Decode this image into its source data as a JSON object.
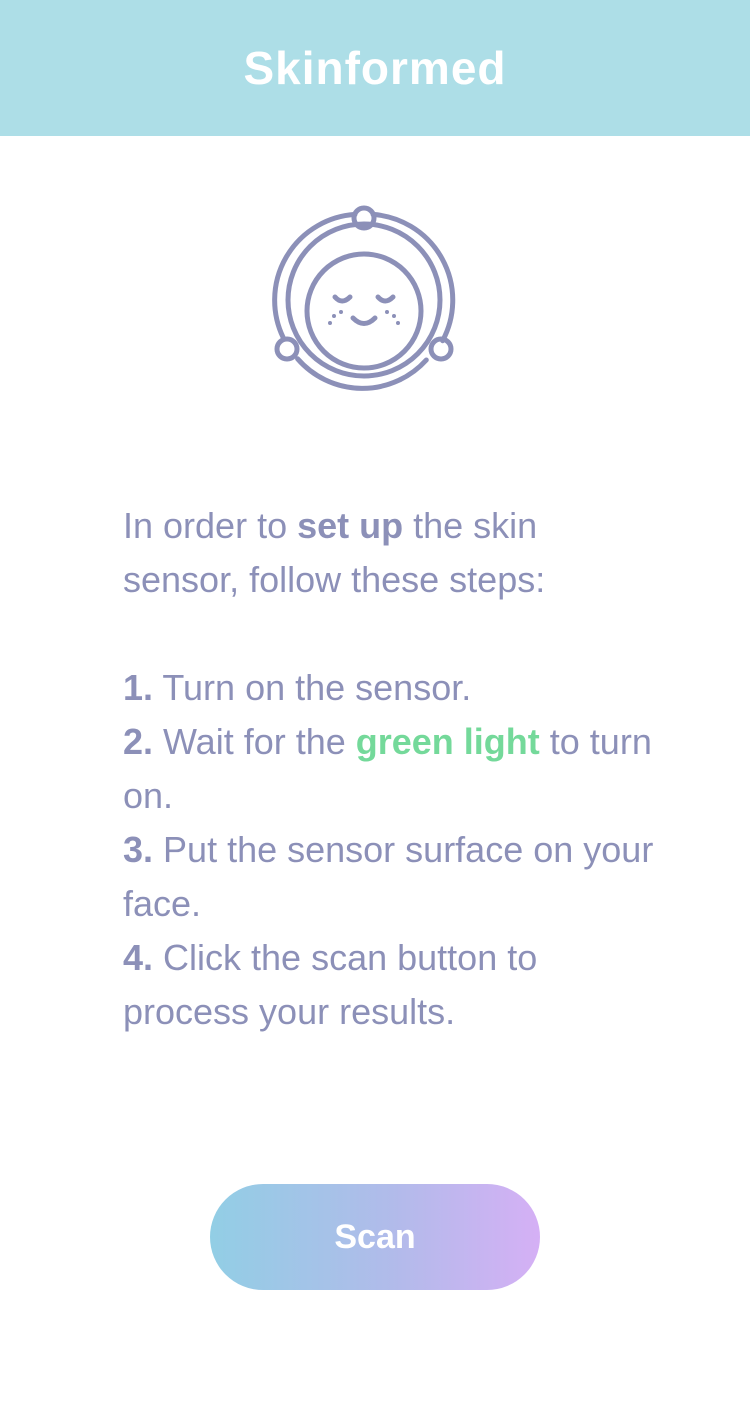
{
  "header": {
    "title": "Skinformed"
  },
  "logo": {
    "icon": "sensor-face-icon",
    "color": "#8c90b8"
  },
  "instructions": {
    "intro": {
      "part1": "In order to ",
      "bold": "set up",
      "part2": " the skin sensor, follow these steps:"
    },
    "steps": [
      {
        "number": "1.",
        "text": " Turn on the sensor."
      },
      {
        "number": "2.",
        "text_before": " Wait for the ",
        "highlight": "green light",
        "text_after": " to turn on."
      },
      {
        "number": "3.",
        "text": " Put the sensor surface on your face."
      },
      {
        "number": "4.",
        "text": " Click the scan button to process your results."
      }
    ]
  },
  "scan_button": {
    "label": "Scan"
  },
  "colors": {
    "header_bg": "#addee7",
    "text": "#8c90b8",
    "highlight": "#74d99a",
    "button_gradient_start": "#92cee5",
    "button_gradient_end": "#d5b0f5"
  }
}
